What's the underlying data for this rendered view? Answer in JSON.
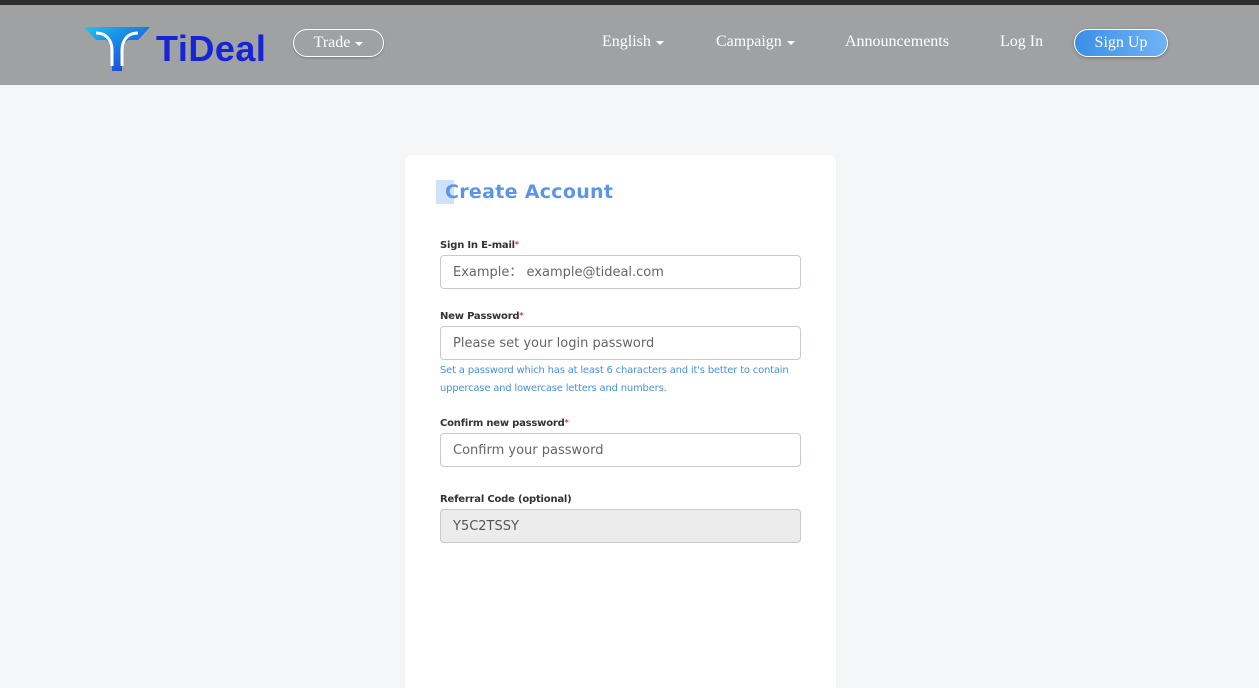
{
  "nav": {
    "logo_text": "TiDeal",
    "trade_label": "Trade",
    "english_label": "English",
    "campaign_label": "Campaign",
    "announcements_label": "Announcements",
    "login_label": "Log In",
    "signup_label": "Sign Up"
  },
  "form": {
    "title": "Create Account",
    "email": {
      "label": "Sign In E-mail",
      "required_mark": "*",
      "placeholder": "Example： example@tideal.com"
    },
    "password": {
      "label": "New Password",
      "required_mark": "*",
      "placeholder": "Please set your login password",
      "hint": "Set a password which has at least 6 characters and it's better to contain uppercase and lowercase letters and numbers."
    },
    "confirm": {
      "label": "Confirm new password",
      "required_mark": "*",
      "placeholder": "Confirm your password"
    },
    "referral": {
      "label": "Referral Code (optional)",
      "value": "Y5C2TSSY"
    }
  },
  "colors": {
    "navbar_bg": "#9fa1a3",
    "brand_blue": "#1424d6",
    "accent_blue": "#4a90e2",
    "required_red": "#e0303a"
  }
}
